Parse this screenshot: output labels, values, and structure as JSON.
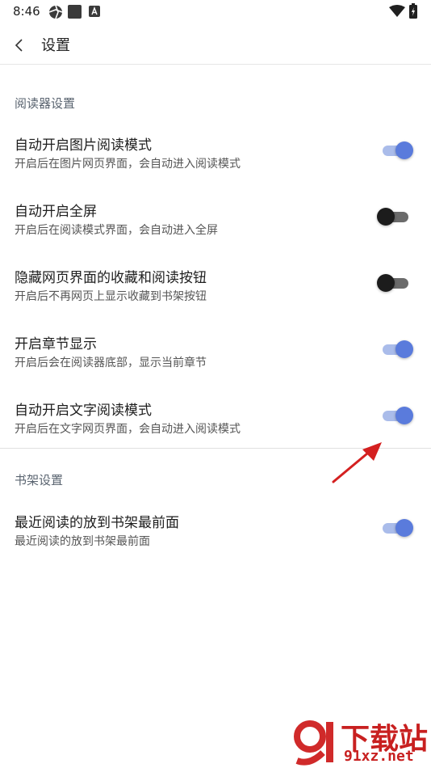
{
  "status_bar": {
    "time": "8:46"
  },
  "app_bar": {
    "title": "设置"
  },
  "sections": [
    {
      "header": "阅读器设置",
      "items": [
        {
          "title": "自动开启图片阅读模式",
          "desc": "开启后在图片网页界面，会自动进入阅读模式",
          "enabled": true
        },
        {
          "title": "自动开启全屏",
          "desc": "开启后在阅读模式界面，会自动进入全屏",
          "enabled": false
        },
        {
          "title": "隐藏网页界面的收藏和阅读按钮",
          "desc": "开启后不再网页上显示收藏到书架按钮",
          "enabled": false
        },
        {
          "title": "开启章节显示",
          "desc": "开启后会在阅读器底部，显示当前章节",
          "enabled": true
        },
        {
          "title": "自动开启文字阅读模式",
          "desc": "开启后在文字网页界面，会自动进入阅读模式",
          "enabled": true
        }
      ]
    },
    {
      "header": "书架设置",
      "items": [
        {
          "title": "最近阅读的放到书架最前面",
          "desc": "最近阅读的放到书架最前面",
          "enabled": true
        }
      ]
    }
  ],
  "watermark": {
    "title": "下载站",
    "url": "91xz.net"
  },
  "colors": {
    "accent": "#5a7bdc",
    "track_on": "#aabcea",
    "annotation_arrow": "#d42020"
  }
}
